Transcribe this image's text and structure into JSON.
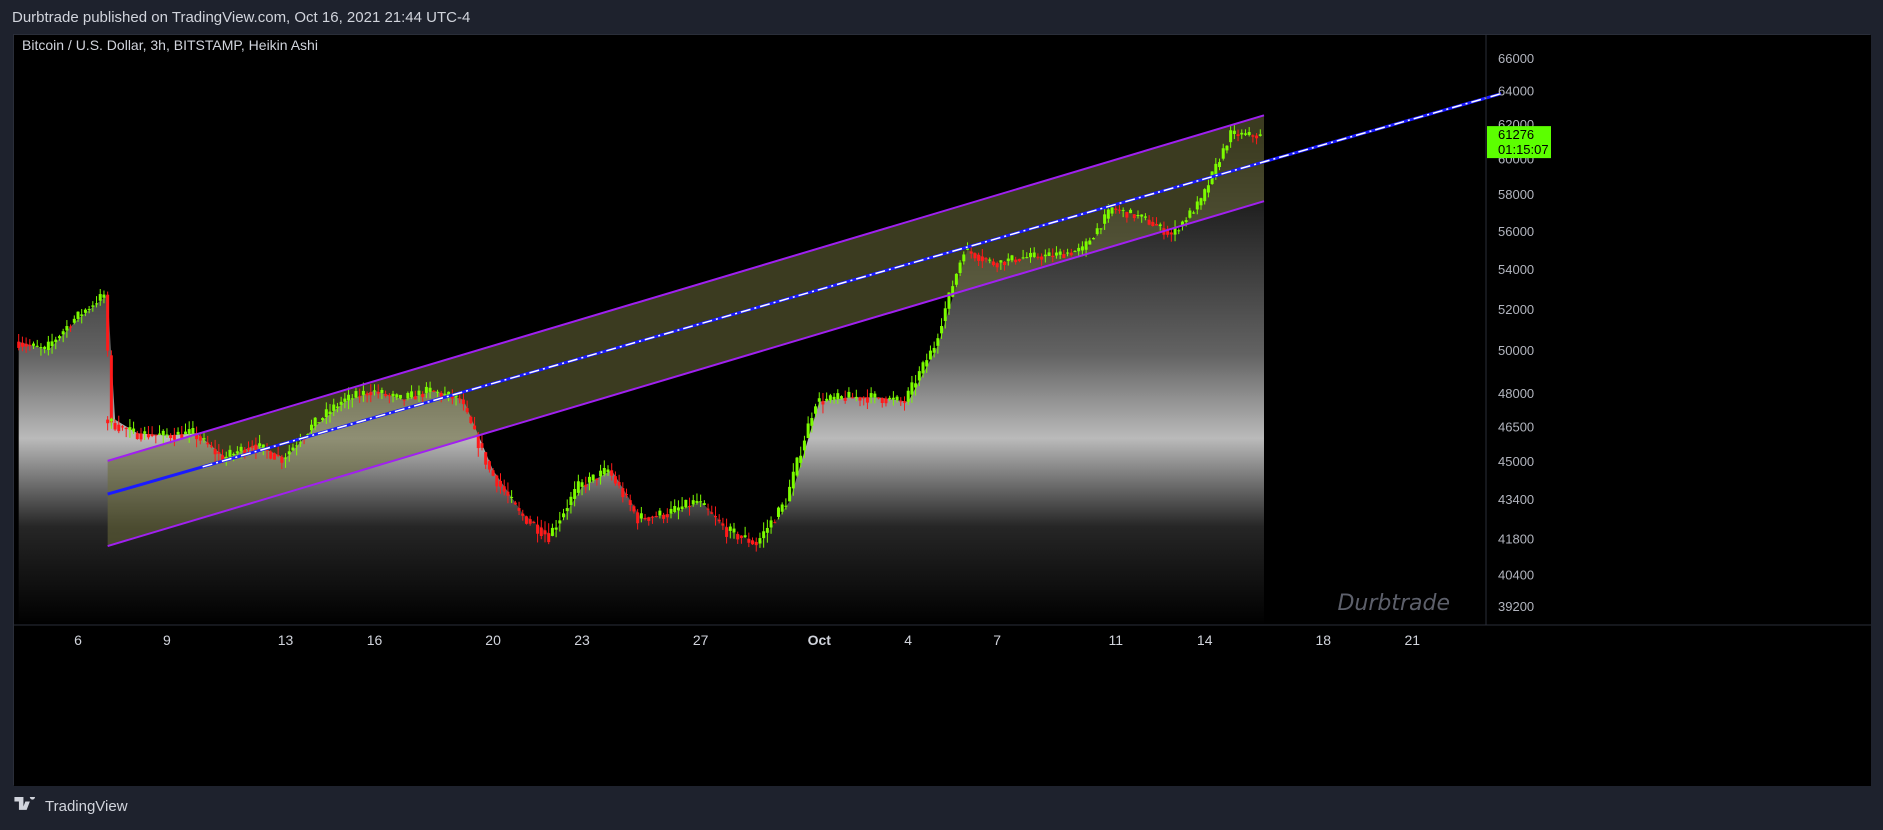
{
  "header": {
    "published_text": "Durbtrade published on TradingView.com, Oct 16, 2021 21:44 UTC-4"
  },
  "footer": {
    "brand_label": "TradingView",
    "logo_icon": "tradingview-logo-icon"
  },
  "colors": {
    "background": "#000000",
    "frame": "#1e222d",
    "up_candle": "#7cfc00",
    "down_candle": "#ff1a1a",
    "channel_line": "#a020f0",
    "channel_fill": "#6b6b3a",
    "trend_line": "#1a1aff",
    "price_badge": "#5cff00"
  },
  "chart_data": {
    "type": "candlestick",
    "title": "Bitcoin / U.S. Dollar, 3h, BITSTAMP, Heikin Ashi",
    "watermark": "Durbtrade",
    "x_axis": {
      "ticks": [
        "6",
        "9",
        "13",
        "16",
        "20",
        "23",
        "27",
        "Oct",
        "4",
        "7",
        "11",
        "14",
        "18",
        "21"
      ],
      "bold_ticks": [
        "Oct"
      ]
    },
    "y_axis": {
      "scale": "log",
      "ticks": [
        66000,
        64000,
        62000,
        60000,
        58000,
        56000,
        54000,
        52000,
        50000,
        48000,
        46500,
        45000,
        43400,
        41800,
        40400,
        39200
      ]
    },
    "last_price": {
      "value": "61276",
      "countdown": "01:15:07"
    },
    "price_path": [
      {
        "date": "Sep 4",
        "close": 50400
      },
      {
        "date": "Sep 5",
        "close": 50000
      },
      {
        "date": "Sep 6",
        "close": 51500
      },
      {
        "date": "Sep 7",
        "close": 52700
      },
      {
        "date": "Sep 7",
        "close": 46800
      },
      {
        "date": "Sep 8",
        "close": 46200
      },
      {
        "date": "Sep 9",
        "close": 46100
      },
      {
        "date": "Sep 10",
        "close": 46200
      },
      {
        "date": "Sep 11",
        "close": 45100
      },
      {
        "date": "Sep 12",
        "close": 45700
      },
      {
        "date": "Sep 13",
        "close": 45100
      },
      {
        "date": "Sep 14",
        "close": 46500
      },
      {
        "date": "Sep 15",
        "close": 47600
      },
      {
        "date": "Sep 16",
        "close": 48100
      },
      {
        "date": "Sep 17",
        "close": 47700
      },
      {
        "date": "Sep 18",
        "close": 48100
      },
      {
        "date": "Sep 19",
        "close": 47700
      },
      {
        "date": "Sep 20",
        "close": 44600
      },
      {
        "date": "Sep 21",
        "close": 42800
      },
      {
        "date": "Sep 22",
        "close": 41900
      },
      {
        "date": "Sep 23",
        "close": 43900
      },
      {
        "date": "Sep 24",
        "close": 44600
      },
      {
        "date": "Sep 25",
        "close": 42600
      },
      {
        "date": "Sep 26",
        "close": 42800
      },
      {
        "date": "Sep 27",
        "close": 43300
      },
      {
        "date": "Sep 28",
        "close": 42100
      },
      {
        "date": "Sep 29",
        "close": 41600
      },
      {
        "date": "Sep 30",
        "close": 43300
      },
      {
        "date": "Oct 1",
        "close": 47600
      },
      {
        "date": "Oct 2",
        "close": 47800
      },
      {
        "date": "Oct 3",
        "close": 47800
      },
      {
        "date": "Oct 4",
        "close": 47600
      },
      {
        "date": "Oct 5",
        "close": 50200
      },
      {
        "date": "Oct 6",
        "close": 55000
      },
      {
        "date": "Oct 7",
        "close": 54300
      },
      {
        "date": "Oct 8",
        "close": 54600
      },
      {
        "date": "Oct 9",
        "close": 54700
      },
      {
        "date": "Oct 10",
        "close": 55000
      },
      {
        "date": "Oct 11",
        "close": 57200
      },
      {
        "date": "Oct 12",
        "close": 56700
      },
      {
        "date": "Oct 13",
        "close": 55800
      },
      {
        "date": "Oct 14",
        "close": 57600
      },
      {
        "date": "Oct 15",
        "close": 61400
      },
      {
        "date": "Oct 16",
        "close": 61276
      }
    ],
    "channel": {
      "start_date": "Sep 7",
      "end_date": "Oct 16",
      "upper": [
        45000,
        62500
      ],
      "middle": [
        43600,
        60200
      ],
      "lower": [
        41500,
        57600
      ],
      "trend_extension_end": {
        "date": "Oct 24",
        "value": 63800
      }
    },
    "grid": false
  }
}
